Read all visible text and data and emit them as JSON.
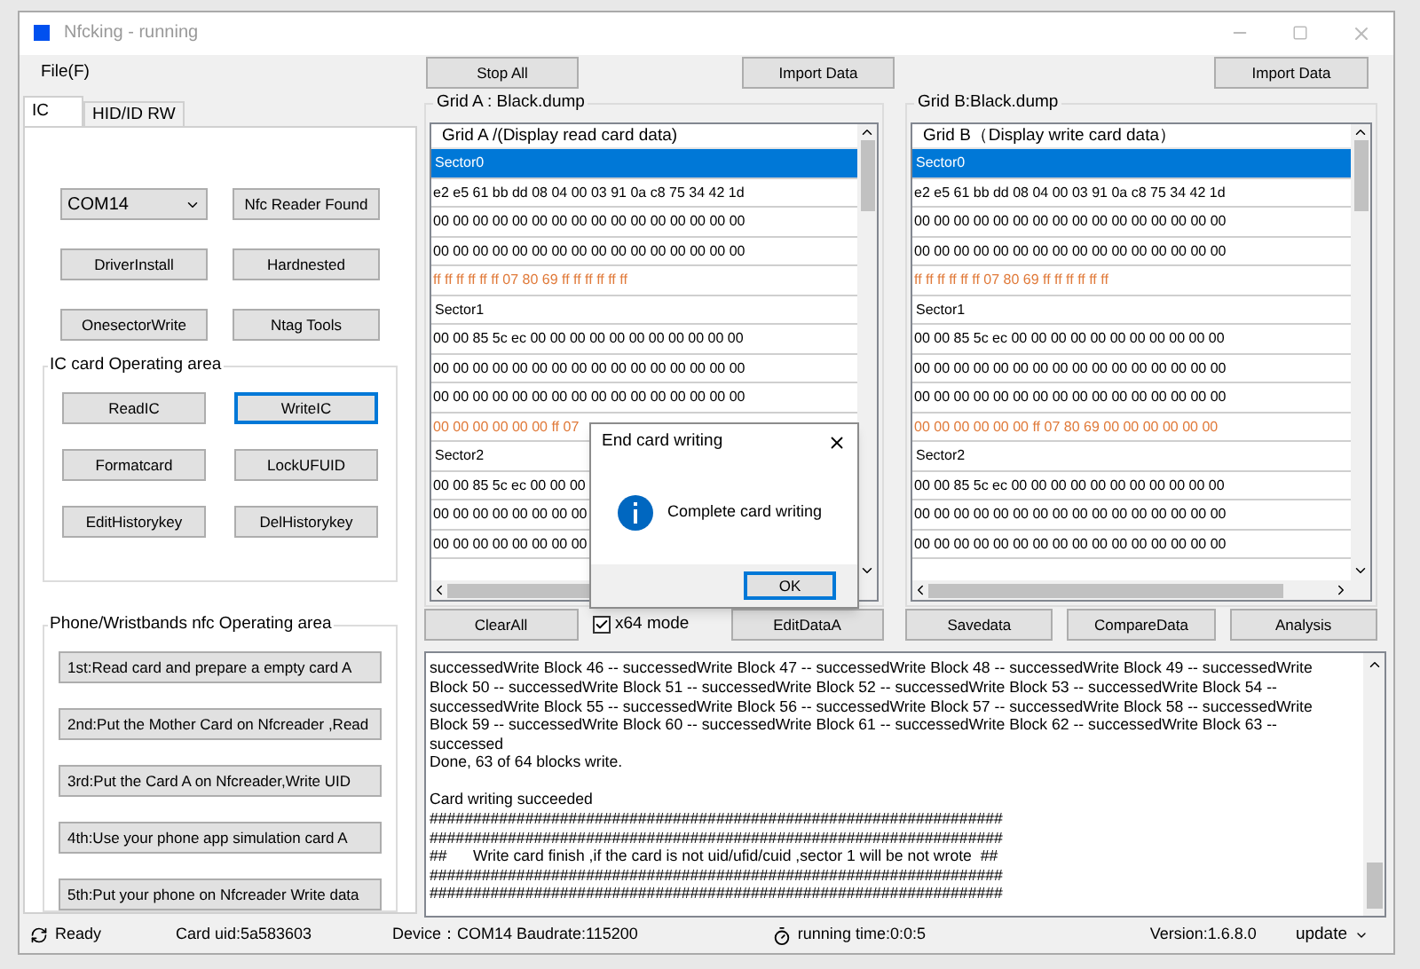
{
  "window": {
    "title": "Nfcking - running"
  },
  "menu": [
    "File(F)"
  ],
  "top_buttons": [
    "Stop All",
    "Import Data",
    "Import Data"
  ],
  "tabs": [
    {
      "label": "IC",
      "selected": true
    },
    {
      "label": "HID/ID RW",
      "selected": false
    }
  ],
  "port_select": {
    "value": "COM14"
  },
  "device_buttons": [
    "Nfc Reader Found",
    "DriverInstall",
    "Hardnested",
    "OnesectorWrite",
    "Ntag Tools"
  ],
  "ic_area": {
    "title": "IC card Operating area",
    "buttons": [
      {
        "label": "ReadIC",
        "focused": false
      },
      {
        "label": "WriteIC",
        "focused": true
      },
      {
        "label": "Formatcard",
        "focused": false
      },
      {
        "label": "LockUFUID",
        "focused": false
      },
      {
        "label": "EditHistorykey",
        "focused": false
      },
      {
        "label": "DelHistorykey",
        "focused": false
      }
    ]
  },
  "phone_area": {
    "title": "Phone/Wristbands nfc Operating area",
    "steps": [
      "1st:Read card and prepare a empty card A",
      "2nd:Put the Mother Card on Nfcreader ,Read",
      "3rd:Put the Card A on Nfcreader,Write UID",
      "4th:Use your phone app simulation card A",
      "5th:Put your phone on Nfcreader Write data"
    ]
  },
  "grids": [
    {
      "title": "Grid A : Black.dump",
      "header": "Grid A /(Display read card data)",
      "rows": [
        {
          "kind": "sector",
          "text": "Sector0",
          "selected": true
        },
        {
          "kind": "data",
          "text": "e2 e5 61 bb dd 08 04 00 03 91 0a c8 75 34 42 1d",
          "selected": false
        },
        {
          "kind": "data",
          "text": "00 00 00 00 00 00 00 00 00 00 00 00 00 00 00 00",
          "selected": false
        },
        {
          "kind": "data",
          "text": "00 00 00 00 00 00 00 00 00 00 00 00 00 00 00 00",
          "selected": false
        },
        {
          "kind": "trailer",
          "text": "ff ff ff ff ff ff 07 80 69 ff ff ff ff ff ff",
          "selected": false
        },
        {
          "kind": "sector",
          "text": "Sector1",
          "selected": false
        },
        {
          "kind": "data",
          "text": "00 00 85 5c ec 00 00 00 00 00 00 00 00 00 00 00",
          "selected": false
        },
        {
          "kind": "data",
          "text": "00 00 00 00 00 00 00 00 00 00 00 00 00 00 00 00",
          "selected": false
        },
        {
          "kind": "data",
          "text": "00 00 00 00 00 00 00 00 00 00 00 00 00 00 00 00",
          "selected": false
        },
        {
          "kind": "trailer",
          "text": "00 00 00 00 00 00 ff 07",
          "selected": false
        },
        {
          "kind": "sector",
          "text": "Sector2",
          "selected": false
        },
        {
          "kind": "data",
          "text": "00 00 85 5c ec 00 00 00",
          "selected": false
        },
        {
          "kind": "data",
          "text": "00 00 00 00 00 00 00 00",
          "selected": false
        },
        {
          "kind": "data",
          "text": "00 00 00 00 00 00 00 00",
          "selected": false
        }
      ],
      "actions": [
        {
          "kind": "button",
          "label": "ClearAll"
        },
        {
          "kind": "checkbox",
          "label": "x64 mode",
          "checked": true
        },
        {
          "kind": "button",
          "label": "EditDataA"
        }
      ]
    },
    {
      "title": "Grid B:Black.dump",
      "header": "Grid B（Display write card data）",
      "rows": [
        {
          "kind": "sector",
          "text": "Sector0",
          "selected": true
        },
        {
          "kind": "data",
          "text": "e2 e5 61 bb dd 08 04 00 03 91 0a c8 75 34 42 1d",
          "selected": false
        },
        {
          "kind": "data",
          "text": "00 00 00 00 00 00 00 00 00 00 00 00 00 00 00 00",
          "selected": false
        },
        {
          "kind": "data",
          "text": "00 00 00 00 00 00 00 00 00 00 00 00 00 00 00 00",
          "selected": false
        },
        {
          "kind": "trailer",
          "text": "ff ff ff ff ff ff 07 80 69 ff ff ff ff ff ff",
          "selected": false
        },
        {
          "kind": "sector",
          "text": "Sector1",
          "selected": false
        },
        {
          "kind": "data",
          "text": "00 00 85 5c ec 00 00 00 00 00 00 00 00 00 00 00",
          "selected": false
        },
        {
          "kind": "data",
          "text": "00 00 00 00 00 00 00 00 00 00 00 00 00 00 00 00",
          "selected": false
        },
        {
          "kind": "data",
          "text": "00 00 00 00 00 00 00 00 00 00 00 00 00 00 00 00",
          "selected": false
        },
        {
          "kind": "trailer",
          "text": "00 00 00 00 00 00 ff 07 80 69 00 00 00 00 00 00",
          "selected": false
        },
        {
          "kind": "sector",
          "text": "Sector2",
          "selected": false
        },
        {
          "kind": "data",
          "text": "00 00 85 5c ec 00 00 00 00 00 00 00 00 00 00 00",
          "selected": false
        },
        {
          "kind": "data",
          "text": "00 00 00 00 00 00 00 00 00 00 00 00 00 00 00 00",
          "selected": false
        },
        {
          "kind": "data",
          "text": "00 00 00 00 00 00 00 00 00 00 00 00 00 00 00 00",
          "selected": false
        }
      ],
      "actions": [
        {
          "kind": "button",
          "label": "Savedata"
        },
        {
          "kind": "button",
          "label": "CompareData"
        },
        {
          "kind": "button",
          "label": "Analysis"
        }
      ]
    }
  ],
  "log": {
    "paragraphs": [
      {
        "lines": [
          "successedWrite Block 46 -- successedWrite Block 47 -- successedWrite Block 48 -- successedWrite Block 49 -- successedWrite",
          "Block 50 -- successedWrite Block 51 -- successedWrite Block 52 -- successedWrite Block 53 -- successedWrite Block 54 --",
          "successedWrite Block 55 -- successedWrite Block 56 -- successedWrite Block 57 -- successedWrite Block 58 -- successedWrite",
          "Block 59 -- successedWrite Block 60 -- successedWrite Block 61 -- successedWrite Block 62 -- successedWrite Block 63 --",
          "successed",
          "Done, 63 of 64 blocks write."
        ]
      },
      {
        "lines": [
          "Card writing succeeded",
          "##################################################################",
          "##################################################################",
          "##      Write card finish ,if the card is not uid/ufid/cuid ,sector 1 will be not wrote  ##",
          "##################################################################",
          "##################################################################"
        ]
      }
    ]
  },
  "status_bar": {
    "ready": "Ready",
    "card_uid": "Card uid:5a583603",
    "device": "Device：COM14  Baudrate:115200",
    "running_time": "running time:0:0:5",
    "version": "Version:1.6.8.0",
    "update": "update"
  },
  "dialog": {
    "title": "End card writing",
    "message": "Complete card writing",
    "button": "OK"
  }
}
